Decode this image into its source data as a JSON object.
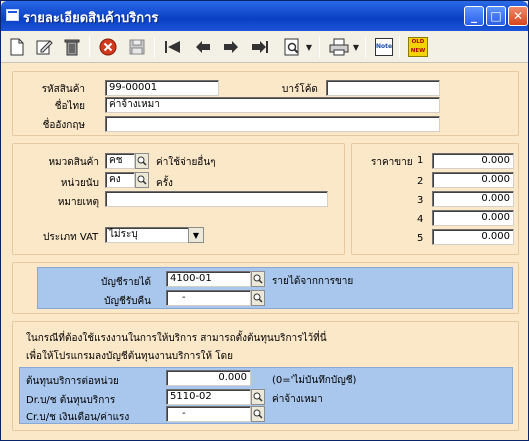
{
  "window": {
    "title": "รายละเอียดสินค้าบริการ",
    "minimize": "_",
    "maximize": "□",
    "close": "✕"
  },
  "toolbar": {
    "icons": [
      "new-icon",
      "edit-icon",
      "delete-icon",
      "cancel-icon",
      "save-icon",
      "first-icon",
      "prev-icon",
      "next-icon",
      "last-icon",
      "search-icon",
      "print-icon",
      "note-icon",
      "old-new-icon"
    ],
    "note_label": "Note",
    "old_label": "OLD",
    "new_label": "NEW"
  },
  "product": {
    "code_label": "รหัสสินค้า",
    "code_value": "99-00001",
    "barcode_label": "บาร์โค้ด",
    "barcode_value": "",
    "thai_name_label": "ชื่อไทย",
    "thai_name_value": "ค่าจ้างเหมา",
    "english_name_label": "ชื่ออังกฤษ",
    "english_name_value": ""
  },
  "details": {
    "category_label": "หมวดสินค้า",
    "category_code": "คช",
    "category_desc": "ค่าใช้จ่ายอื่นๆ",
    "unit_label": "หน่วยนับ",
    "unit_code": "คง",
    "unit_desc": "ครั้ง",
    "remark_label": "หมายเหตุ",
    "remark_value": "",
    "vat_label": "ประเภท VAT",
    "vat_value": "ไม่ระบุ",
    "price_label": "ราคาขาย",
    "prices": [
      {
        "n": "1",
        "v": "0.000"
      },
      {
        "n": "2",
        "v": "0.000"
      },
      {
        "n": "3",
        "v": "0.000"
      },
      {
        "n": "4",
        "v": "0.000"
      },
      {
        "n": "5",
        "v": "0.000"
      }
    ]
  },
  "accounts": {
    "income_label": "บัญชีรายได้",
    "income_code": "4100-01",
    "income_desc": "รายได้จากการขาย",
    "refund_label": "บัญชีรับคืน",
    "refund_code": "-"
  },
  "labor": {
    "note_line1": "ในกรณีที่ต้องใช้แรงงานในการให้บริการ สามารถตั้งต้นทุนบริการไว้ที่นี่",
    "note_line2": "เพื่อให้โปรแกรมลงบัญชีต้นทุนงานบริการให้ โดย",
    "cost_label": "ต้นทุนบริการต่อหน่วย",
    "cost_value": "0.000",
    "cost_hint": "(0='ไม่บันทึกบัญชี)",
    "dr_label": "Dr.บ/ช ต้นทุนบริการ",
    "dr_code": "5110-02",
    "dr_desc": "ค่าจ้างเหมา",
    "cr_label": "Cr.บ/ช เงินเดือน/ค่าแรง",
    "cr_code": "-"
  }
}
